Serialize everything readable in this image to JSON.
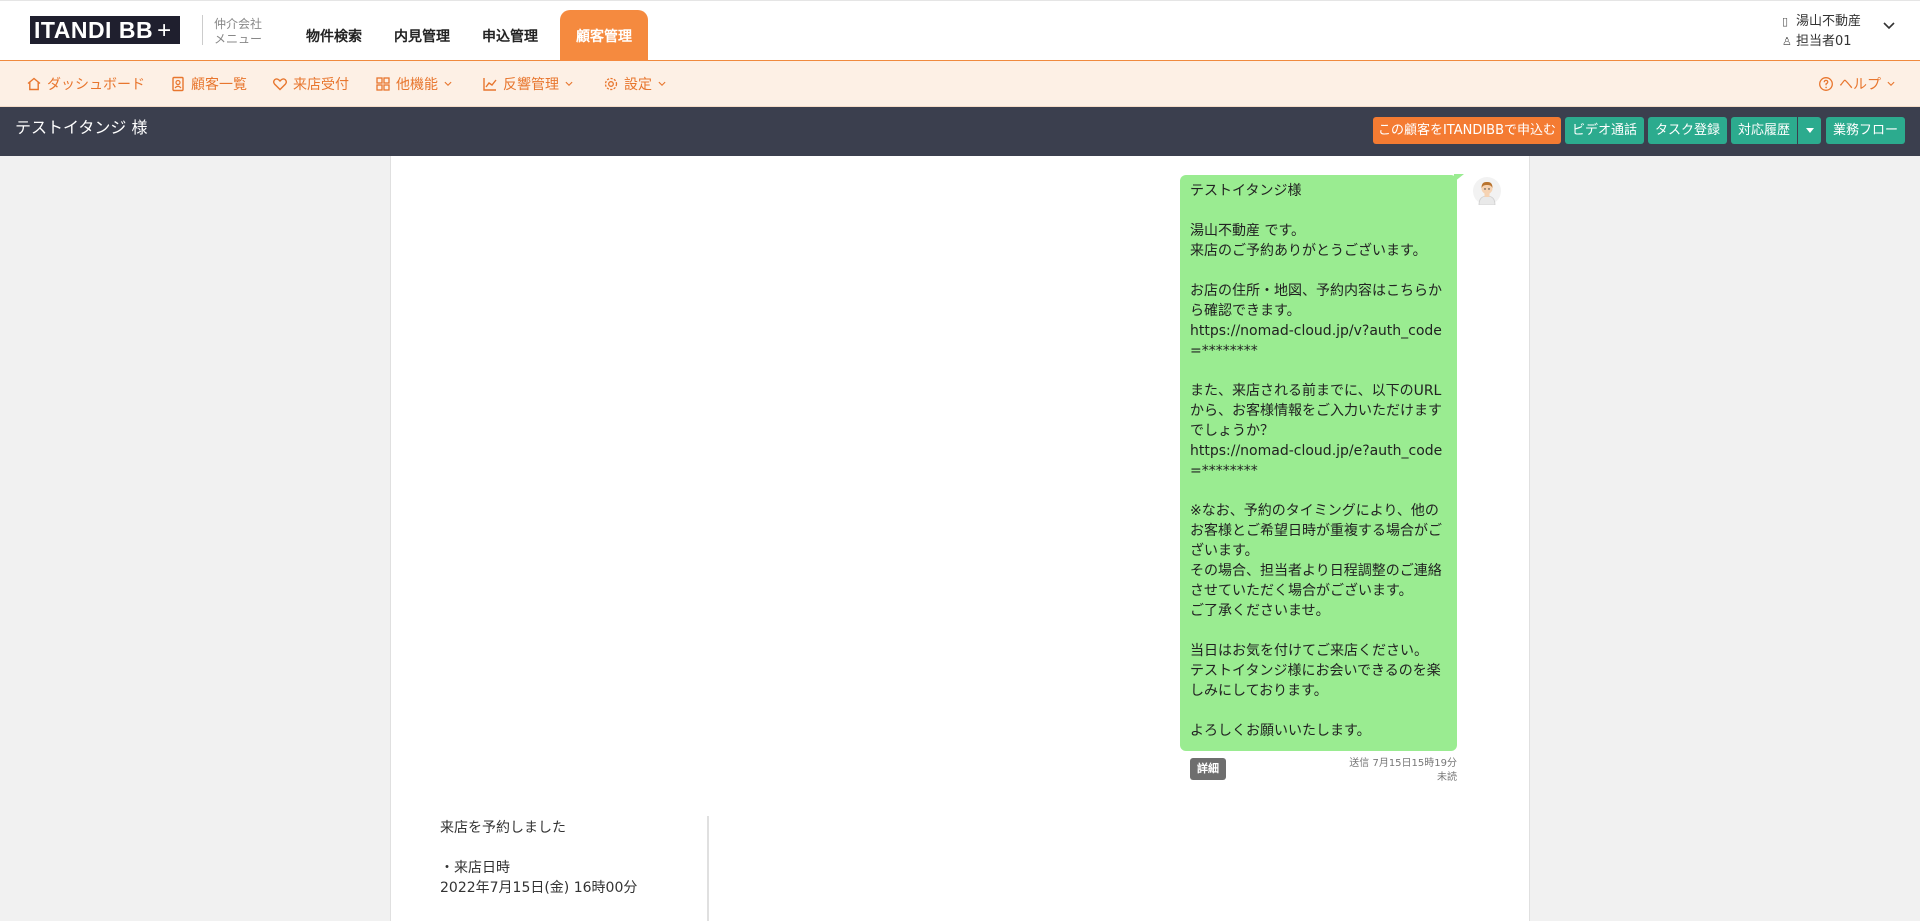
{
  "header": {
    "logo_text": "ITANDI BB",
    "logo_plus": "+",
    "broker_menu": [
      "仲介会社",
      "メニュー"
    ],
    "nav": [
      {
        "label": "物件検索",
        "active": false
      },
      {
        "label": "内見管理",
        "active": false
      },
      {
        "label": "申込管理",
        "active": false
      },
      {
        "label": "顧客管理",
        "active": true
      }
    ],
    "company": "湯山不動産",
    "staff": "担当者01"
  },
  "subnav": {
    "items": [
      {
        "label": "ダッシュボード",
        "icon": "home-icon",
        "dropdown": false
      },
      {
        "label": "顧客一覧",
        "icon": "contact-list-icon",
        "dropdown": false
      },
      {
        "label": "来店受付",
        "icon": "heart-hand-icon",
        "dropdown": false
      },
      {
        "label": "他機能",
        "icon": "grid-icon",
        "dropdown": true
      },
      {
        "label": "反響管理",
        "icon": "chart-icon",
        "dropdown": true
      },
      {
        "label": "設定",
        "icon": "gear-icon",
        "dropdown": true
      }
    ],
    "help": "ヘルプ"
  },
  "titlebar": {
    "customer_name": "テストイタンジ 様",
    "buttons": {
      "apply": "この顧客をITANDIBBで申込む",
      "video": "ビデオ通話",
      "task": "タスク登録",
      "history": "対応履歴",
      "workflow": "業務フロー"
    }
  },
  "message": {
    "body": "テストイタンジ様\n\n湯山不動産 です。\n来店のご予約ありがとうございます。\n\nお店の住所・地図、予約内容はこちらから確認できます。\nhttps://nomad-cloud.jp/v?auth_code=********\n\nまた、来店される前までに、以下のURLから、お客様情報をご入力いただけますでしょうか？\nhttps://nomad-cloud.jp/e?auth_code=********\n\n※なお、予約のタイミングにより、他のお客様とご希望日時が重複する場合がございます。\nその場合、担当者より日程調整のご連絡させていただく場合がございます。\nご了承くださいませ。\n\n当日はお気を付けてご来店ください。\nテストイタンジ様にお会いできるのを楽しみにしております。\n\nよろしくお願いいたします。",
    "detail_label": "詳細",
    "sent_at": "送信 7月15日15時19分",
    "read_status": "未読"
  },
  "visit": {
    "text": "来店を予約しました\n\n・来店日時\n2022年7月15日(金) 16時00分"
  },
  "colors": {
    "accent": "#f58a3f",
    "green_button": "#2cab8e",
    "bubble": "#9aec91",
    "titlebar": "#3b3f4e"
  }
}
